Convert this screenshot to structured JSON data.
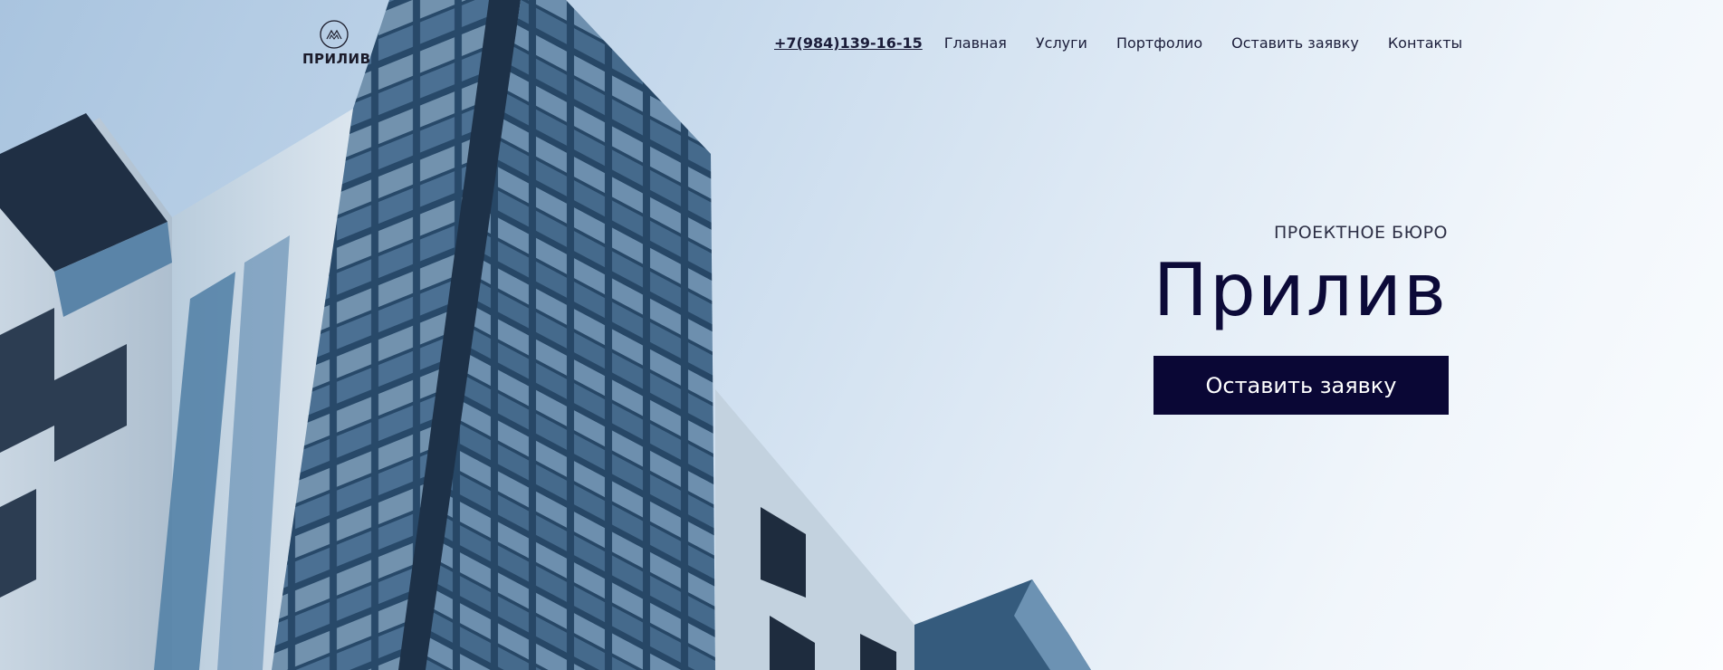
{
  "logo": {
    "text": "ПРИЛИВ",
    "icon": "mountain-circle-icon"
  },
  "nav": {
    "phone": "+7(984)139-16-15",
    "items": [
      "Главная",
      "Услуги",
      "Портфолио",
      "Оставить заявку",
      "Контакты"
    ]
  },
  "hero": {
    "subtitle": "ПРОЕКТНОЕ БЮРО",
    "title": "Прилив",
    "cta_label": "Оставить заявку",
    "background": "building-photo"
  },
  "colors": {
    "brand_dark": "#0a0735",
    "text_dark": "#1b1d3a",
    "sky_light": "#f1f6fb",
    "glass": "#3f6b91"
  }
}
